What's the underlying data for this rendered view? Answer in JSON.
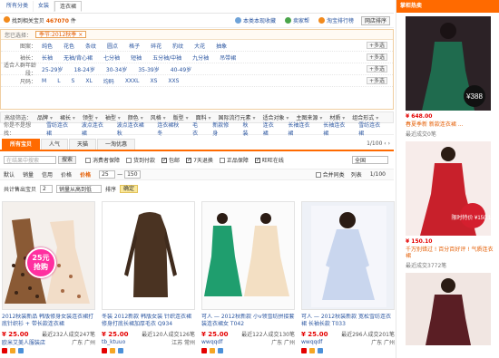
{
  "topnav": {
    "tabs": [
      "所有分类",
      "女装",
      "连衣裙"
    ]
  },
  "infobar": {
    "found_prefix": "找到相关宝贝",
    "found_count": "467070",
    "found_suffix": "件",
    "links": [
      "本类本现收藏",
      "卖家帮",
      "淘宝排行榜"
    ],
    "view_select": "网店排序"
  },
  "filters": {
    "selected_label": "您已选择：",
    "selected_chip": "季节:2012秋季 ×",
    "rows": [
      {
        "label": "图案：",
        "options": [
          "纯色",
          "花色",
          "条纹",
          "圆点",
          "格子",
          "碎花",
          "豹纹",
          "大花",
          "抽象"
        ],
        "more": "+多选"
      },
      {
        "label": "袖长：",
        "options": [
          "长袖",
          "无袖/背心裙",
          "七分袖",
          "短袖",
          "五分袖/中袖",
          "九分袖",
          "吊带裙"
        ],
        "more": "+多选"
      },
      {
        "label": "适合人群年龄段：",
        "options": [
          "25-29岁",
          "18-24岁",
          "30-34岁",
          "35-39岁",
          "40-49岁"
        ],
        "more": "+多选"
      },
      {
        "label": "尺码：",
        "options": [
          "M",
          "L",
          "S",
          "XL",
          "均码",
          "XXXL",
          "XS",
          "XXS"
        ],
        "more": "+多选"
      }
    ]
  },
  "sortrow": {
    "label": "高级筛选：",
    "dropdowns": [
      "品牌",
      "裙长",
      "领型",
      "袖型",
      "颜色",
      "风格",
      "版型",
      "面料",
      "国际流行元素",
      "适合对象",
      "主图来源",
      "材质",
      "组合形式"
    ]
  },
  "tagrow": {
    "label": "你是不是想找：",
    "tags": [
      "雪纺连衣裙",
      "波点连衣裙",
      "波点连衣裙秋",
      "连衣裙秋冬",
      "毛衣",
      "新款修身",
      "秋装",
      "连衣裙",
      "长袖连衣裙",
      "长袖连衣裙",
      "雪纺连衣裙"
    ]
  },
  "tabs": {
    "items": [
      "所有宝贝",
      "人气",
      "天猫",
      "一淘优惠"
    ],
    "pager": "1/100  ‹ ›"
  },
  "tool1": {
    "search_placeholder": "在结果中搜索",
    "search_button": "搜索",
    "checks": [
      "消费者保障",
      "货到付款",
      "包邮",
      "7天退换",
      "正品保障",
      "旺旺在线"
    ],
    "checked": [
      false,
      false,
      true,
      true,
      false,
      true
    ],
    "location": "全国"
  },
  "tool2": {
    "items": [
      "默认",
      "销量",
      "信用",
      "价格",
      "价格",
      "25",
      "—",
      "150"
    ],
    "merge": "合并同类",
    "views": "列表",
    "page": "1/100"
  },
  "tool3": {
    "label": "共计售出宝贝",
    "count": "2",
    "filter": "销量从高到低",
    "sort": "排序",
    "confirm": "确定"
  },
  "products": [
    {
      "title": "2012秋装新品 韩版修身女装连衣裙打底针织衫 + 带长款连衣裙",
      "price": "¥ 25.00",
      "sold": "最近232人成交247笔",
      "shop": "欧米艾美人服装店",
      "loc": "广东 广州",
      "badge": "25元抢购"
    },
    {
      "title": "冬装 2012新款 韩版女装 针织连衣裙修身打底长裙加厚毛衣 Q934",
      "price": "¥ 25.00",
      "sold": "最近120人成交126笔",
      "shop": "tb_ktuuo",
      "loc": "江苏 常州",
      "badge": ""
    },
    {
      "title": "可人 — 2012秋新款 小v领雪纺拼接套装连衣裙女 T042",
      "price": "¥ 25.00",
      "sold": "最近122人成交130笔",
      "shop": "wwqqdf",
      "loc": "广东 广州",
      "badge": ""
    },
    {
      "title": "可人 — 2012秋装新款 宽松雪纺连衣裙 长袖长款 T033",
      "price": "¥ 25.00",
      "sold": "最近296人成交201笔",
      "shop": "wwqqdf",
      "loc": "广东 广州",
      "badge": ""
    }
  ],
  "sidebar": {
    "title": "掌柜热卖",
    "items": [
      {
        "price": "¥ 648.00",
        "desc": "春夏季新 新款连衣裙 ...",
        "sold": "最近成交0笔",
        "tag": "¥388"
      },
      {
        "price": "¥ 150.10",
        "desc": "千万别错过 ! 百分百好评 ! 气质连衣裙",
        "sold": "最近成交3772笔",
        "tag": "限时特价 ¥150.10"
      },
      {
        "price": "",
        "desc": "",
        "sold": "",
        "tag": ""
      }
    ]
  }
}
